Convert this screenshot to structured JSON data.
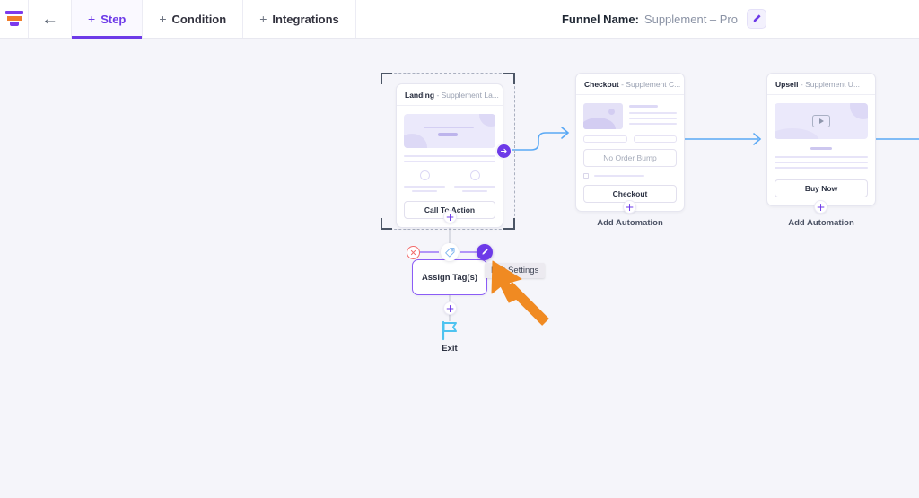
{
  "topbar": {
    "logo_icon": "funnel-logo-icon",
    "back_icon": "back-arrow-icon",
    "items": [
      {
        "label": "Step",
        "icon": "plus-icon",
        "active": true
      },
      {
        "label": "Condition",
        "icon": "plus-icon",
        "active": false
      },
      {
        "label": "Integrations",
        "icon": "plus-icon",
        "active": false
      }
    ],
    "plus_glyph": "+",
    "back_glyph": "←",
    "funnel_name_label": "Funnel Name:",
    "funnel_name_value": "Supplement – Pro",
    "edit_icon": "pencil-icon"
  },
  "colors": {
    "accent": "#6d3ae8",
    "accent_light": "#8b5cf6",
    "edge_blue": "#5aa9f5",
    "canvas_bg": "#f5f5fa",
    "danger": "#f26b6b",
    "tag_icon": "#7fb6ef",
    "exit_flag": "#4ec3f0",
    "logo_orange": "#f07d2b",
    "cursor_orange": "#f08a22"
  },
  "canvas": {
    "steps": [
      {
        "type": "landing",
        "title": "Landing",
        "subtitle": "- Supplement La...",
        "selected": true,
        "cta_label": "Call To Action",
        "add_label": "",
        "plus_glyph": "+"
      },
      {
        "type": "checkout",
        "title": "Checkout",
        "subtitle": "- Supplement C...",
        "selected": false,
        "order_bump_label": "No Order Bump",
        "cta_label": "Checkout",
        "add_label": "Add Automation",
        "plus_glyph": "+"
      },
      {
        "type": "upsell",
        "title": "Upsell",
        "subtitle": "- Supplement U...",
        "selected": false,
        "video_icon": "play-icon",
        "cta_label": "Buy Now",
        "add_label": "Add Automation",
        "plus_glyph": "+"
      }
    ],
    "automation_node": {
      "label": "Assign Tag(s)",
      "delete_icon": "close-circle-icon",
      "delete_glyph": "✕",
      "tag_icon": "tag-icon",
      "edit_icon": "pencil-icon",
      "tooltip": "Edit Settings",
      "plus_glyph": "+"
    },
    "exit_node": {
      "label": "Exit",
      "icon": "flag-icon"
    },
    "source_handle_icon": "arrow-right-circle-icon",
    "cursor_icon": "mouse-pointer-icon"
  }
}
